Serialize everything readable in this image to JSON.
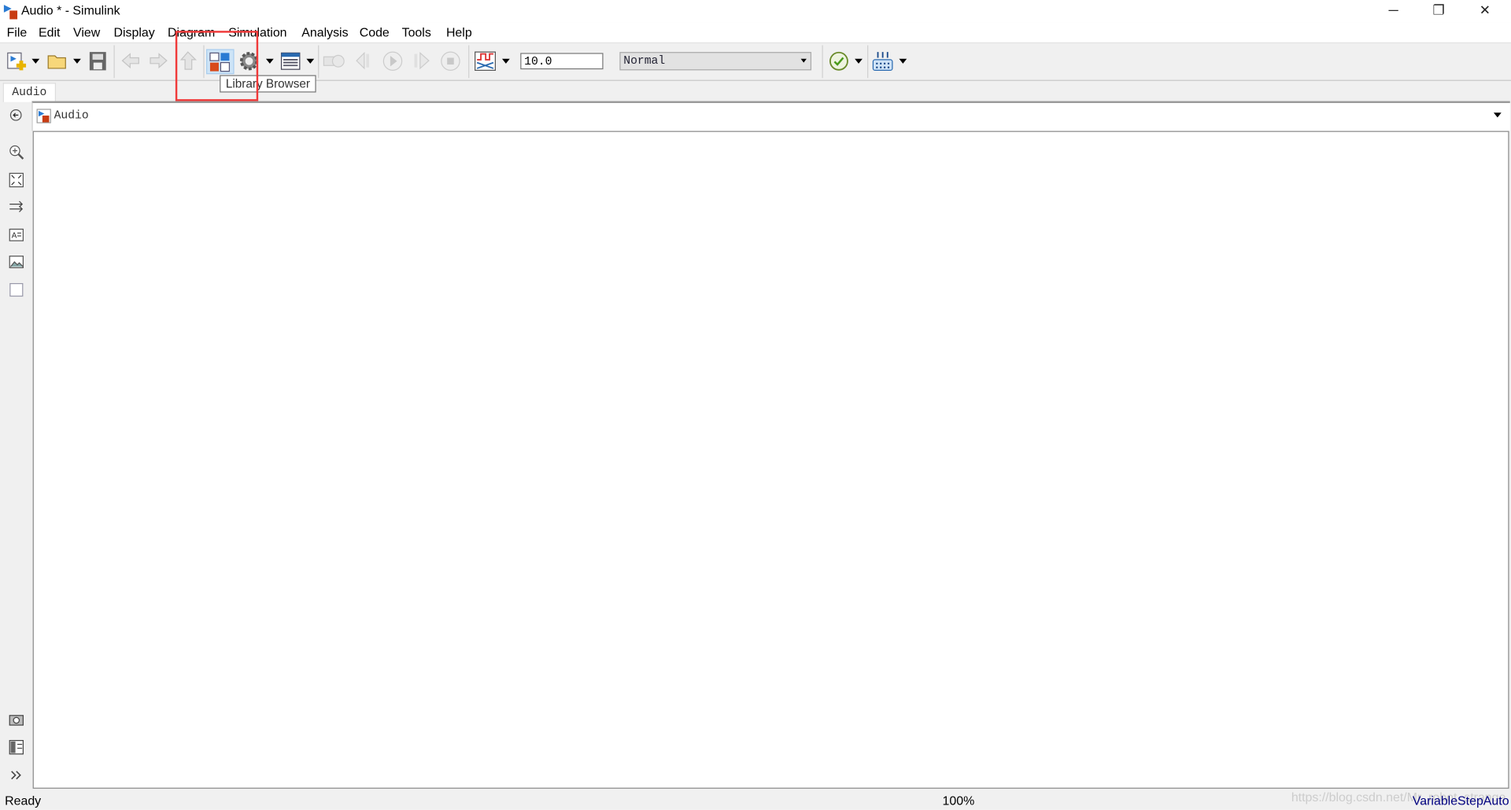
{
  "window": {
    "title": "Audio * - Simulink",
    "minimize": "─",
    "restore": "❐",
    "close": "✕"
  },
  "menu": [
    "File",
    "Edit",
    "View",
    "Display",
    "Diagram",
    "Simulation",
    "Analysis",
    "Code",
    "Tools",
    "Help"
  ],
  "toolbar": {
    "stop_time": "10.0",
    "sim_mode": "Normal",
    "tooltip": "Library Browser"
  },
  "tabs": [
    {
      "label": "Audio"
    }
  ],
  "address": {
    "path": "Audio"
  },
  "status": {
    "left": "Ready",
    "zoom": "100%",
    "solver": "VariableStepAuto",
    "watermark": "https://blog.csdn.net/Mr_robot_strange"
  },
  "colors": {
    "highlight": "#f03a3a",
    "solver_text": "#000080"
  }
}
